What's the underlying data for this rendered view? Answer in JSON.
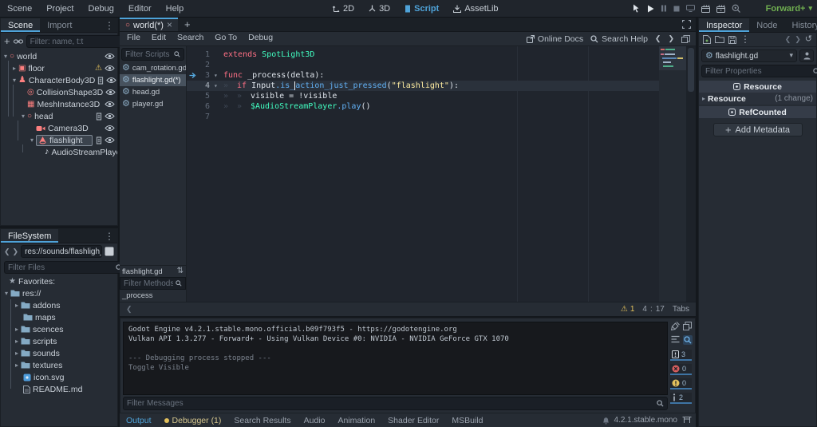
{
  "topbar": {
    "menus": [
      "Scene",
      "Project",
      "Debug",
      "Editor",
      "Help"
    ],
    "workspace_2d": "2D",
    "workspace_3d": "3D",
    "workspace_script": "Script",
    "workspace_assetlib": "AssetLib",
    "renderer": "Forward+"
  },
  "scene_dock": {
    "tab_scene": "Scene",
    "tab_import": "Import",
    "filter_placeholder": "Filter: name, t:t",
    "nodes": {
      "world": "world",
      "floor": "floor",
      "character_body": "CharacterBody3D",
      "collision_shape": "CollisionShape3D",
      "mesh_instance": "MeshInstance3D",
      "head": "head",
      "camera": "Camera3D",
      "flashlight": "flashlight",
      "audio_stream_player": "AudioStreamPlayer"
    }
  },
  "filesystem": {
    "tab": "FileSystem",
    "path": "res://sounds/flashligh_butt",
    "filter_placeholder": "Filter Files",
    "favorites": "Favorites:",
    "root": "res://",
    "folders": {
      "addons": "addons",
      "maps": "maps",
      "scences": "scences",
      "scripts": "scripts",
      "sounds": "sounds",
      "textures": "textures"
    },
    "files": {
      "icon": "icon.svg",
      "readme": "README.md"
    }
  },
  "script_editor": {
    "scene_tab": "world(*)",
    "menus": [
      "File",
      "Edit",
      "Search",
      "Go To",
      "Debug"
    ],
    "online_docs": "Online Docs",
    "search_help": "Search Help",
    "filter_scripts": "Filter Scripts",
    "scripts": [
      "cam_rotation.gd",
      "flashlight.gd(*)",
      "head.gd",
      "player.gd"
    ],
    "current_script": "flashlight.gd",
    "filter_methods": "Filter Methods",
    "method": "_process",
    "code": {
      "ln": [
        "1",
        "2",
        "3",
        "4",
        "5",
        "6",
        "7"
      ],
      "l1_kw": "extends",
      "l1_type": " SpotLight3D",
      "l3_kw": "func",
      "l3_rest": " _process(delta):",
      "l4_kw": "if",
      "l4_sp": " ",
      "l4_obj": "Input",
      "l4_m1": ".is_",
      "l4_m2": "action_just_pressed",
      "l4_p": "(",
      "l4_str": "\"flashlight\"",
      "l4_e": "):",
      "l5": "visible = !visible",
      "l6_node": "$AudioStreamPlayer",
      "l6_fn": ".play",
      "l6_e": "()"
    },
    "status": {
      "warnings": "1",
      "line": "4",
      "colon": ":",
      "col": "17",
      "indent": "Tabs"
    }
  },
  "output": {
    "lines": [
      "Godot Engine v4.2.1.stable.mono.official.b09f793f5 - https://godotengine.org",
      "Vulkan API 1.3.277 - Forward+ - Using Vulkan Device #0: NVIDIA - NVIDIA GeForce GTX 1070",
      "--- Debugging process stopped ---",
      "Toggle Visible"
    ],
    "filter_placeholder": "Filter Messages",
    "badge_msgs": "3",
    "badge_errors": "0",
    "badge_warnings": "0",
    "badge_info": "2",
    "tabs": [
      "Output",
      "Debugger (1)",
      "Search Results",
      "Audio",
      "Animation",
      "Shader Editor",
      "MSBuild"
    ],
    "version": "4.2.1.stable.mono"
  },
  "inspector": {
    "tab_inspector": "Inspector",
    "tab_node": "Node",
    "tab_history": "History",
    "script_name": "flashlight.gd",
    "filter_placeholder": "Filter Properties",
    "section_resource": "Resource",
    "resource_row": "Resource",
    "change_note": "(1 change)",
    "section_refcounted": "RefCounted",
    "add_metadata": "Add Metadata"
  },
  "colors": {
    "accent": "#4fa3d9",
    "node_red": "#fc7f7f",
    "warning": "#e2c05c",
    "renderer_green": "#6fae50"
  }
}
